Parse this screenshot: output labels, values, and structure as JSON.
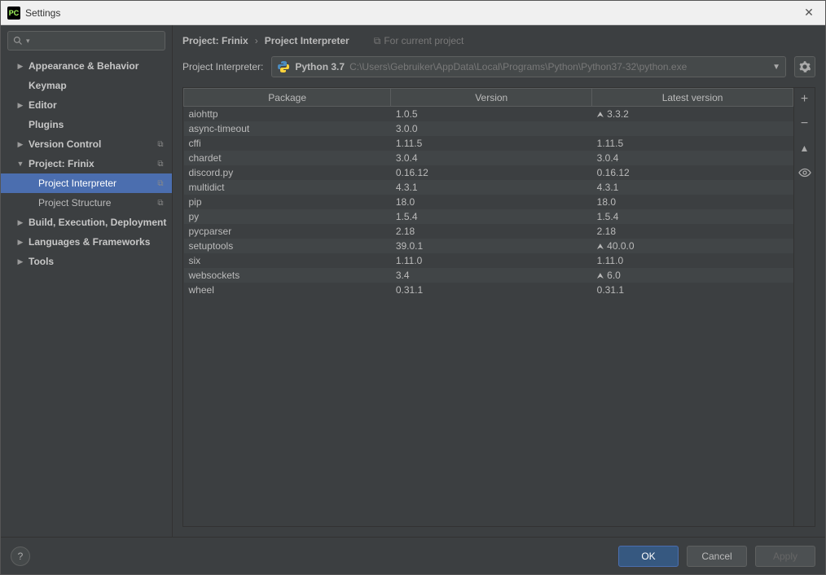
{
  "window": {
    "title": "Settings"
  },
  "sidebar": {
    "search_placeholder": "",
    "items": [
      {
        "label": "Appearance & Behavior",
        "arrow": "right",
        "bold": true
      },
      {
        "label": "Keymap",
        "arrow": "none",
        "bold": true
      },
      {
        "label": "Editor",
        "arrow": "right",
        "bold": true
      },
      {
        "label": "Plugins",
        "arrow": "none",
        "bold": true
      },
      {
        "label": "Version Control",
        "arrow": "right",
        "bold": true,
        "copy": true
      },
      {
        "label": "Project: Frinix",
        "arrow": "down",
        "bold": true,
        "copy": true
      },
      {
        "label": "Project Interpreter",
        "arrow": "none",
        "child": true,
        "selected": true,
        "copy": true
      },
      {
        "label": "Project Structure",
        "arrow": "none",
        "child": true,
        "copy": true
      },
      {
        "label": "Build, Execution, Deployment",
        "arrow": "right",
        "bold": true
      },
      {
        "label": "Languages & Frameworks",
        "arrow": "right",
        "bold": true
      },
      {
        "label": "Tools",
        "arrow": "right",
        "bold": true
      }
    ]
  },
  "main": {
    "breadcrumb": {
      "root": "Project: Frinix",
      "leaf": "Project Interpreter"
    },
    "hint": "For current project",
    "interpreter_label": "Project Interpreter:",
    "interpreter": {
      "name": "Python 3.7",
      "path": "C:\\Users\\Gebruiker\\AppData\\Local\\Programs\\Python\\Python37-32\\python.exe"
    },
    "columns": {
      "package": "Package",
      "version": "Version",
      "latest": "Latest version"
    },
    "packages": [
      {
        "name": "aiohttp",
        "version": "1.0.5",
        "latest": "3.3.2",
        "upgrade": true
      },
      {
        "name": "async-timeout",
        "version": "3.0.0",
        "latest": ""
      },
      {
        "name": "cffi",
        "version": "1.11.5",
        "latest": "1.11.5"
      },
      {
        "name": "chardet",
        "version": "3.0.4",
        "latest": "3.0.4"
      },
      {
        "name": "discord.py",
        "version": "0.16.12",
        "latest": "0.16.12"
      },
      {
        "name": "multidict",
        "version": "4.3.1",
        "latest": "4.3.1"
      },
      {
        "name": "pip",
        "version": "18.0",
        "latest": "18.0"
      },
      {
        "name": "py",
        "version": "1.5.4",
        "latest": "1.5.4"
      },
      {
        "name": "pycparser",
        "version": "2.18",
        "latest": "2.18"
      },
      {
        "name": "setuptools",
        "version": "39.0.1",
        "latest": "40.0.0",
        "upgrade": true
      },
      {
        "name": "six",
        "version": "1.11.0",
        "latest": "1.11.0"
      },
      {
        "name": "websockets",
        "version": "3.4",
        "latest": "6.0",
        "upgrade": true
      },
      {
        "name": "wheel",
        "version": "0.31.1",
        "latest": "0.31.1"
      }
    ]
  },
  "footer": {
    "ok": "OK",
    "cancel": "Cancel",
    "apply": "Apply"
  }
}
